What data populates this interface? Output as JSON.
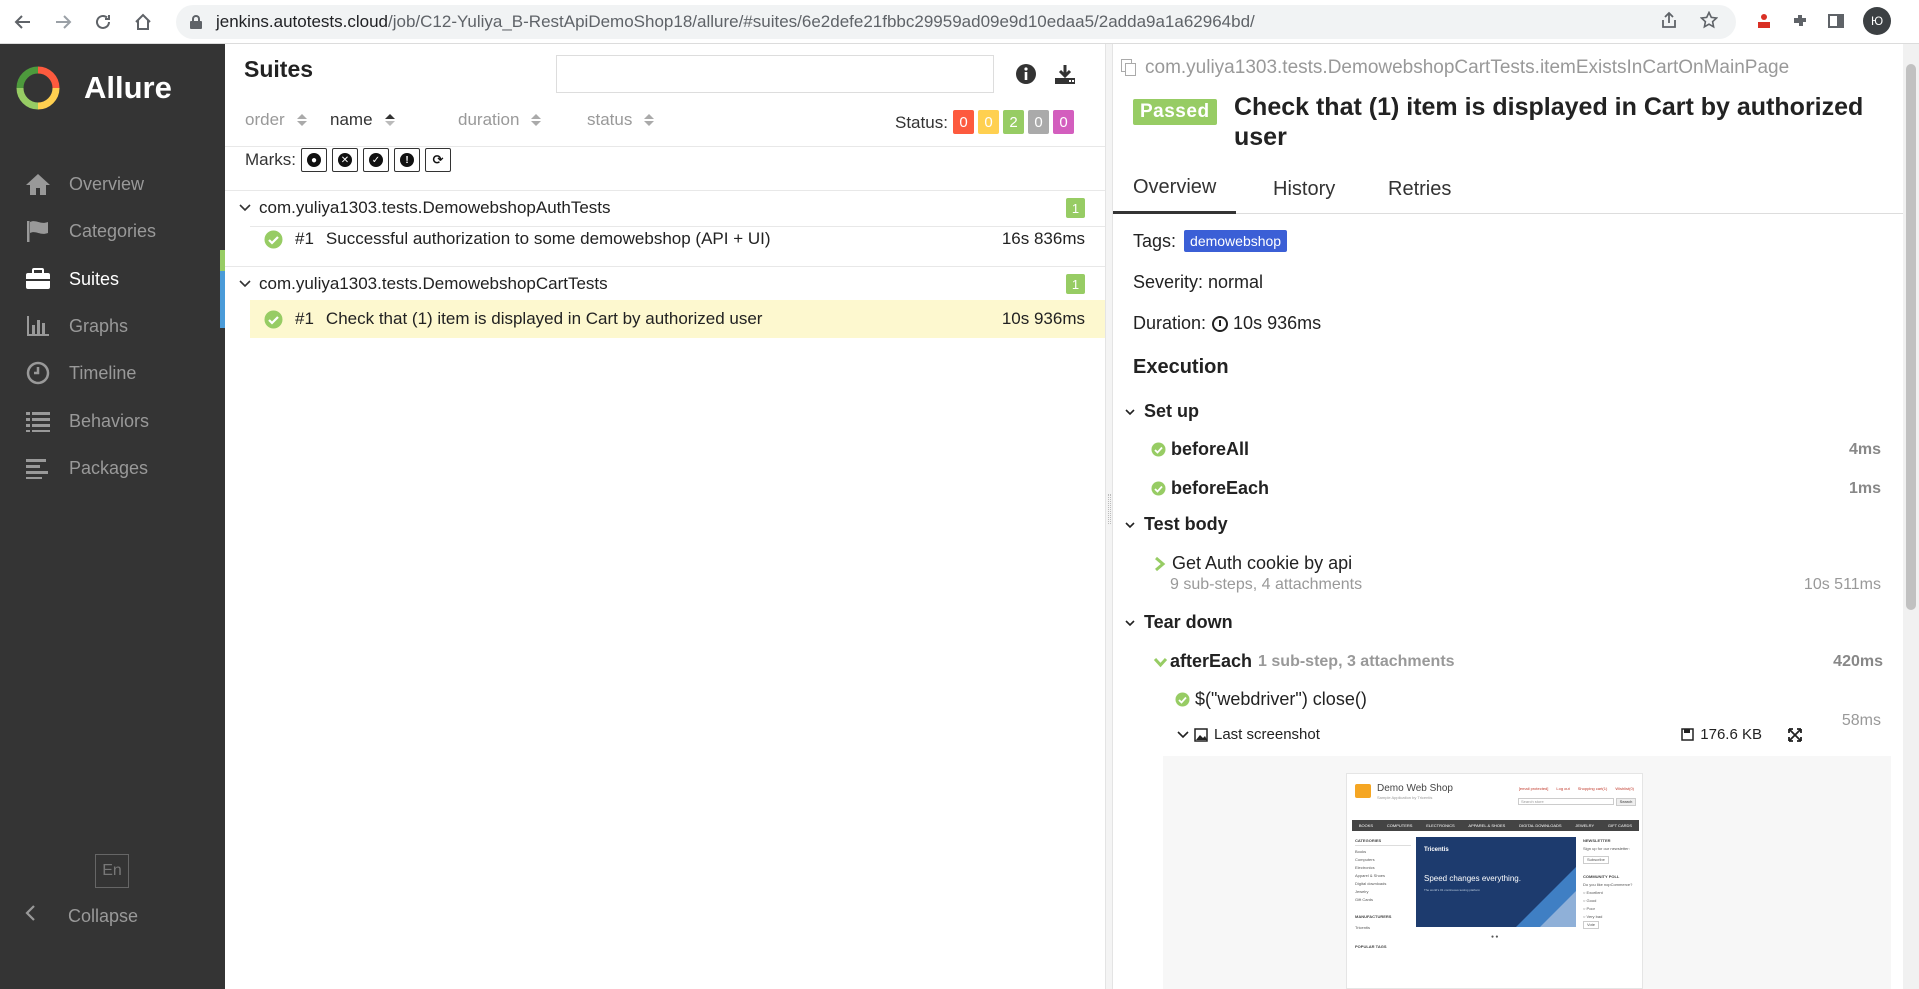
{
  "browser": {
    "url_host": "jenkins.autotests.cloud",
    "url_path": "/job/C12-Yuliya_B-RestApiDemoShop18/allure/#suites/6e2defe21fbbc29959ad09e9d10edaa5/2adda9a1a62964bd/",
    "profile_initials": "Ю"
  },
  "sidebar": {
    "brand": "Allure",
    "items": [
      {
        "label": "Overview",
        "icon": "home-icon"
      },
      {
        "label": "Categories",
        "icon": "flag-icon"
      },
      {
        "label": "Suites",
        "icon": "briefcase-icon"
      },
      {
        "label": "Graphs",
        "icon": "bar-chart-icon"
      },
      {
        "label": "Timeline",
        "icon": "clock-icon"
      },
      {
        "label": "Behaviors",
        "icon": "list-icon"
      },
      {
        "label": "Packages",
        "icon": "align-left-icon"
      }
    ],
    "active_item": "Suites",
    "language": "En",
    "collapse_label": "Collapse"
  },
  "suites": {
    "title": "Suites",
    "search_placeholder": "",
    "sort": {
      "order": "order",
      "name": "name",
      "duration": "duration",
      "status": "status"
    },
    "status_label": "Status:",
    "status_counts": [
      {
        "value": "0",
        "color": "#fd5a3e"
      },
      {
        "value": "0",
        "color": "#ffd050"
      },
      {
        "value": "2",
        "color": "#97cc64"
      },
      {
        "value": "0",
        "color": "#aaaaaa"
      },
      {
        "value": "0",
        "color": "#d35ebe"
      }
    ],
    "marks_label": "Marks:",
    "groups": [
      {
        "name": "com.yuliya1303.tests.DemowebshopAuthTests",
        "count": "1",
        "tests": [
          {
            "num": "#1",
            "name": "Successful authorization to some demowebshop (API + UI)",
            "duration": "16s 836ms"
          }
        ]
      },
      {
        "name": "com.yuliya1303.tests.DemowebshopCartTests",
        "count": "1",
        "tests": [
          {
            "num": "#1",
            "name": "Check that (1) item is displayed in Cart by authorized user",
            "duration": "10s 936ms"
          }
        ]
      }
    ]
  },
  "detail": {
    "breadcrumb": "com.yuliya1303.tests.DemowebshopCartTests.itemExistsInCartOnMainPage",
    "status": "Passed",
    "status_color": "#97cc64",
    "title": "Check that (1) item is displayed in Cart by authorized user",
    "tabs": [
      "Overview",
      "History",
      "Retries"
    ],
    "tags_label": "Tags:",
    "tag": "demowebshop",
    "severity": "Severity: normal",
    "duration_label": "Duration:",
    "duration": "10s 936ms",
    "execution_label": "Execution",
    "setup": {
      "label": "Set up",
      "steps": [
        {
          "name": "beforeAll",
          "duration": "4ms"
        },
        {
          "name": "beforeEach",
          "duration": "1ms"
        }
      ]
    },
    "body": {
      "label": "Test body",
      "step": "Get Auth cookie by api",
      "meta": "9 sub-steps, 4 attachments",
      "duration": "10s 511ms"
    },
    "teardown": {
      "label": "Tear down",
      "step": "afterEach",
      "meta": "1 sub-step, 3 attachments",
      "duration": "420ms",
      "substep": "$(\"webdriver\") close()",
      "substep_duration": "58ms",
      "attachment": "Last screenshot",
      "attachment_size": "176.6 KB"
    },
    "screenshot": {
      "site_title": "Demo Web Shop",
      "site_subtitle": "Sample Application by Tricentis",
      "top_links": [
        "[email protected]",
        "Log out",
        "Shopping cart(1)",
        "Wishlist(0)"
      ],
      "search_placeholder": "Search store",
      "search_btn": "Search",
      "menu": [
        "BOOKS",
        "COMPUTERS",
        "ELECTRONICS",
        "APPAREL & SHOES",
        "DIGITAL DOWNLOADS",
        "JEWELRY",
        "GIFT CARDS"
      ],
      "categories_h": "CATEGORIES",
      "categories": [
        "Books",
        "Computers",
        "Electronics",
        "Apparel & Shoes",
        "Digital downloads",
        "Jewelry",
        "Gift Cards"
      ],
      "manufacturers_h": "MANUFACTURERS",
      "manufacturer": "Tricentis",
      "popular_h": "POPULAR TAGS",
      "banner_brand": "Tricentis",
      "banner_headline": "Speed changes everything.",
      "banner_sub": "The world's #1 continuous testing platform",
      "newsletter_h": "NEWSLETTER",
      "newsletter_text": "Sign up for our newsletter:",
      "subscribe": "Subscribe",
      "poll_h": "COMMUNITY POLL",
      "poll_q": "Do you like nopCommerce?",
      "poll_opts": [
        "Excellent",
        "Good",
        "Poor",
        "Very bad"
      ],
      "vote": "Vote"
    }
  }
}
